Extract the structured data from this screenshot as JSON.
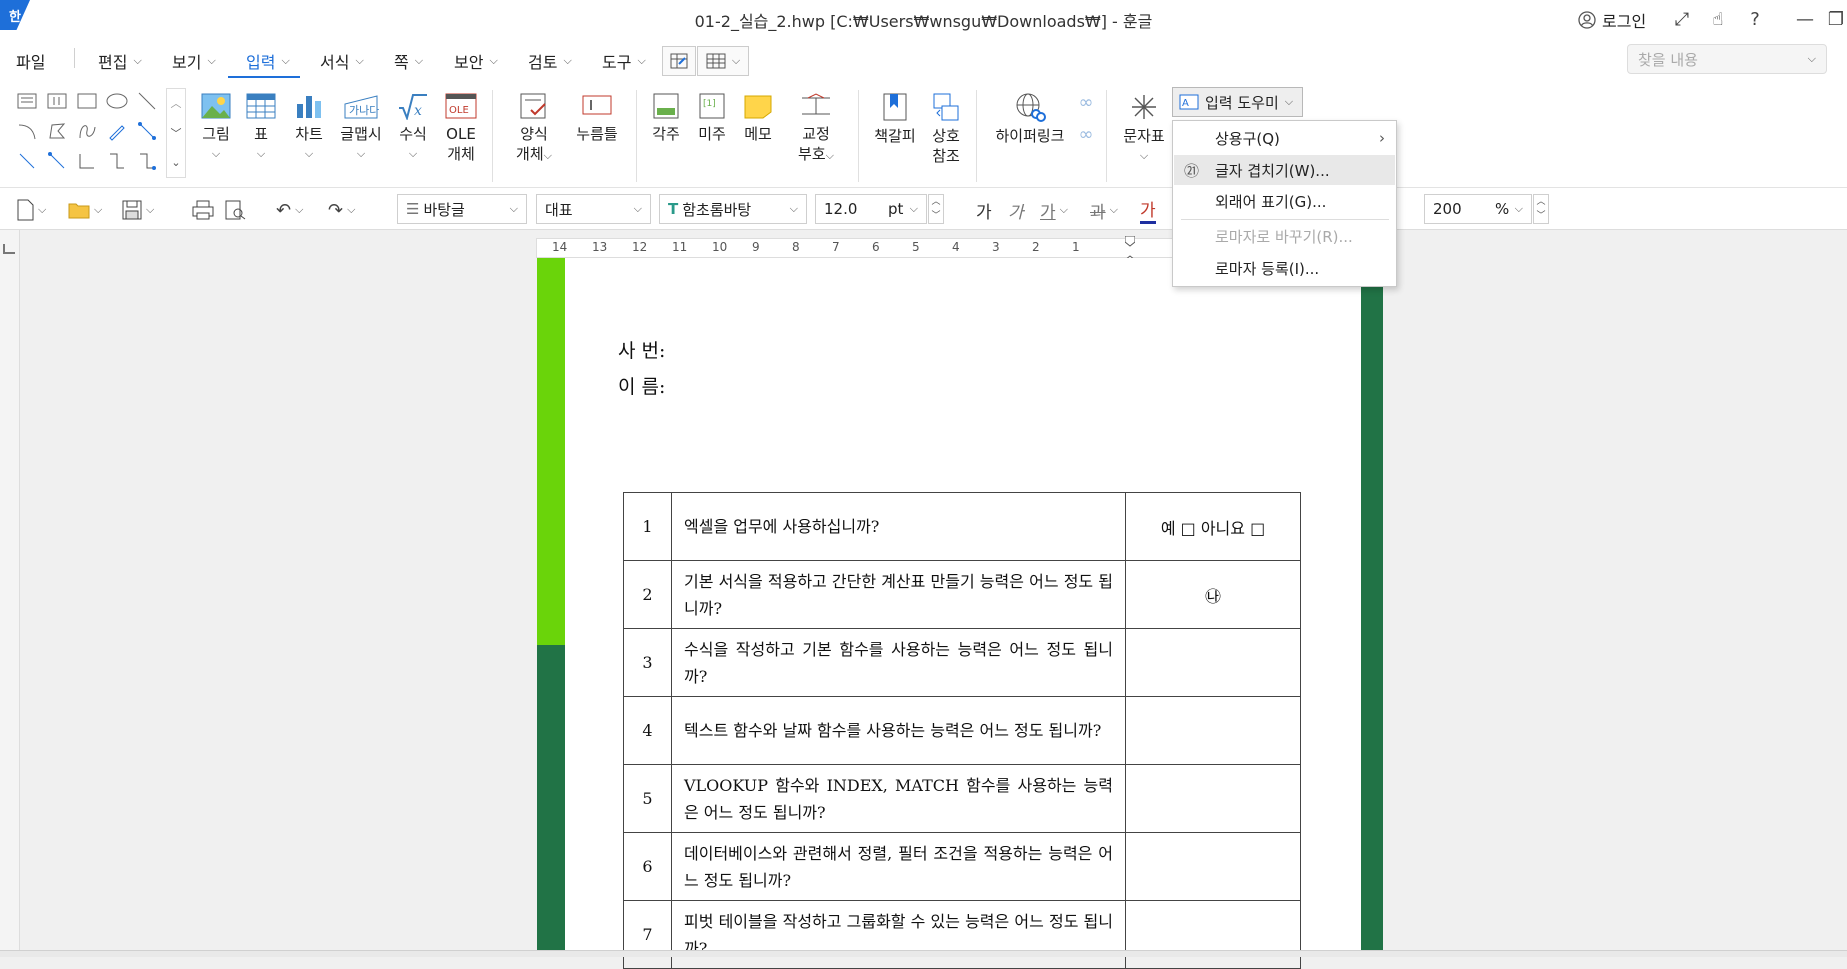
{
  "app": {
    "badge": "한",
    "window_title": "01-2_실습_2.hwp [C:₩Users₩wnsgu₩Downloads₩] - 훈글",
    "login_label": "로그인"
  },
  "menu": {
    "items": [
      "파일",
      "편집",
      "보기",
      "입력",
      "서식",
      "쪽",
      "보안",
      "검토",
      "도구"
    ],
    "active": "입력",
    "find_placeholder": "찾을 내용"
  },
  "ribbon": {
    "buttons": {
      "picture": "그림",
      "table": "표",
      "chart": "차트",
      "wordart": "글맵시",
      "formula": "수식",
      "ole_line1": "OLE",
      "ole_line2": "개체",
      "form_line1": "양식",
      "form_line2": "개체",
      "push_button": "누름틀",
      "footnote": "각주",
      "endnote": "미주",
      "memo": "메모",
      "proof_line1": "교정",
      "proof_line2": "부호",
      "bookmark": "책갈피",
      "cross_line1": "상호",
      "cross_line2": "참조",
      "hyperlink": "하이퍼링크",
      "symbol": "문자표"
    },
    "input_helper": "입력 도우미"
  },
  "toolbar": {
    "style_combo": "바탕글",
    "lang_combo": "대표",
    "font_combo": "함초롬바탕",
    "font_size": "12.0",
    "size_unit": "pt",
    "zoom_value": "200",
    "zoom_unit": "%",
    "bold_glyph": "가",
    "italic_glyph": "가",
    "underline_glyph": "가",
    "strike_glyph": "과",
    "color_glyph": "가"
  },
  "ruler": {
    "ticks": [
      "14",
      "13",
      "12",
      "11",
      "10",
      "9",
      "8",
      "7",
      "6",
      "5",
      "4",
      "3",
      "2",
      "1"
    ]
  },
  "dropdown": {
    "items": [
      {
        "label": "상용구(Q)",
        "state": "normal"
      },
      {
        "label": "글자 겹치기(W)...",
        "state": "hover"
      },
      {
        "label": "외래어 표기(G)...",
        "state": "normal"
      },
      {
        "label": "로마자로 바꾸기(R)...",
        "state": "disabled"
      },
      {
        "label": "로마자 등록(I)...",
        "state": "normal"
      }
    ],
    "circled_glyph": "㉑"
  },
  "document": {
    "field_id": "사 번:",
    "field_name": "이 름:",
    "rows": [
      {
        "num": "1",
        "question": "엑셀을 업무에 사용하십니까?",
        "answer": "예 □ 아니요 □"
      },
      {
        "num": "2",
        "question": "기본 서식을 적용하고 간단한 계산표 만들기 능력은 어느 정도 됩니까?",
        "answer": "㉯"
      },
      {
        "num": "3",
        "question": "수식을 작성하고 기본 함수를 사용하는 능력은 어느 정도 됩니까?",
        "answer": ""
      },
      {
        "num": "4",
        "question": "텍스트 함수와 날짜 함수를 사용하는 능력은 어느 정도 됩니까?",
        "answer": ""
      },
      {
        "num": "5",
        "question": "VLOOKUP 함수와 INDEX, MATCH 함수를 사용하는 능력은 어느 정도 됩니까?",
        "answer": ""
      },
      {
        "num": "6",
        "question": "데이터베이스와 관련해서 정렬, 필터 조건을 적용하는 능력은 어느 정도 됩니까?",
        "answer": ""
      },
      {
        "num": "7",
        "question": "피벗 테이블을 작성하고 그룹화할 수 있는 능력은 어느 정도 됩니까?",
        "answer": ""
      }
    ]
  },
  "colors": {
    "accent": "#1e6fd9",
    "left_bar_light": "#6ad40a",
    "side_bar_dark": "#217346"
  }
}
